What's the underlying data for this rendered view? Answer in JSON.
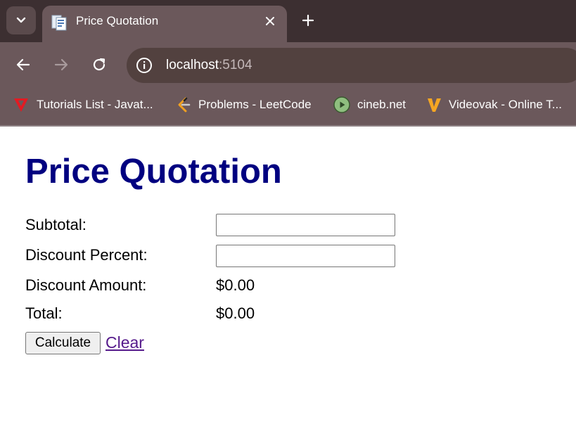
{
  "browser": {
    "tab": {
      "title": "Price Quotation"
    },
    "address": {
      "host": "localhost",
      "port": ":5104"
    },
    "bookmarks": [
      {
        "label": "Tutorials List - Javat...",
        "icon": "javatpoint-icon"
      },
      {
        "label": "Problems - LeetCode",
        "icon": "leetcode-icon"
      },
      {
        "label": "cineb.net",
        "icon": "play-icon"
      },
      {
        "label": "Videovak - Online T...",
        "icon": "videovak-icon"
      }
    ]
  },
  "page": {
    "title": "Price Quotation",
    "form": {
      "subtotal": {
        "label": "Subtotal:",
        "value": ""
      },
      "discount_percent": {
        "label": "Discount Percent:",
        "value": ""
      },
      "discount_amount": {
        "label": "Discount Amount:",
        "value": "$0.00"
      },
      "total": {
        "label": "Total:",
        "value": "$0.00"
      }
    },
    "calculate_label": "Calculate",
    "clear_label": "Clear"
  },
  "colors": {
    "title": "#000080",
    "link": "#551a8b",
    "chrome_tab": "#6b585b",
    "chrome_strip": "#3c2f31"
  }
}
